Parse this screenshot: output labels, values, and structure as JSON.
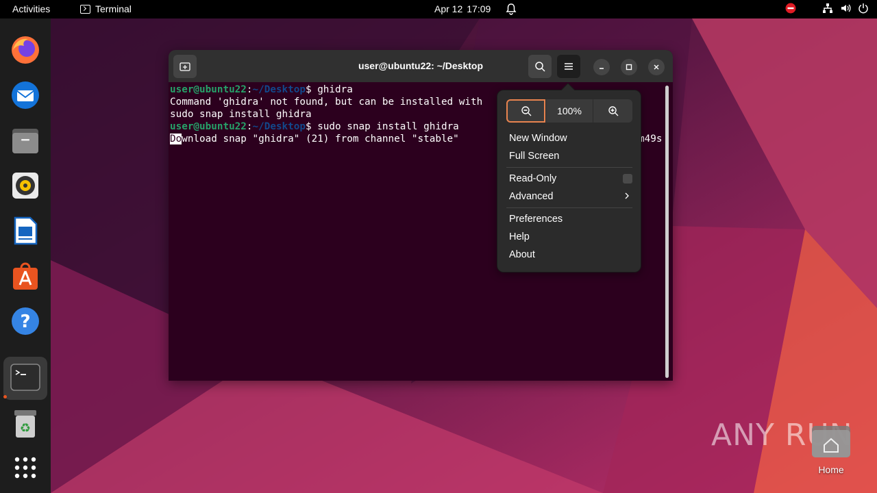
{
  "topbar": {
    "activities": "Activities",
    "app_name": "Terminal",
    "date": "Apr 12",
    "time": "17:09"
  },
  "dock": {
    "items": [
      {
        "name": "Firefox"
      },
      {
        "name": "Thunderbird"
      },
      {
        "name": "Files"
      },
      {
        "name": "Rhythmbox"
      },
      {
        "name": "LibreOffice Writer"
      },
      {
        "name": "Ubuntu Software"
      },
      {
        "name": "Help"
      },
      {
        "name": "Terminal",
        "active": true
      },
      {
        "name": "Trash"
      },
      {
        "name": "Show Applications"
      }
    ]
  },
  "terminal": {
    "title": "user@ubuntu22: ~/Desktop",
    "lines": [
      {
        "user": "user@ubuntu22",
        "sep": ":",
        "path": "~/Desktop",
        "dollar": "$ ",
        "cmd": "ghidra"
      },
      {
        "text": "Command 'ghidra' not found, but can be installed with"
      },
      {
        "text": "sudo snap install ghidra"
      },
      {
        "user": "user@ubuntu22",
        "sep": ":",
        "path": "~/Desktop",
        "dollar": "$ ",
        "cmd": "sudo snap install ghidra"
      },
      {
        "cursor": "Do",
        "text": "wnload snap \"ghidra\" (21) from channel \"stable\""
      }
    ],
    "right_fragment": "m49s"
  },
  "menu": {
    "zoom_value": "100%",
    "items_group1": [
      "New Window",
      "Full Screen"
    ],
    "read_only": "Read-Only",
    "advanced": "Advanced",
    "items_group3": [
      "Preferences",
      "Help",
      "About"
    ]
  },
  "desktop": {
    "home_label": "Home",
    "watermark": "ANY RUN"
  },
  "colors": {
    "accent": "#e95420",
    "terminal_bg": "#2c001e",
    "prompt_user": "#26a269",
    "prompt_path": "#12488b"
  }
}
